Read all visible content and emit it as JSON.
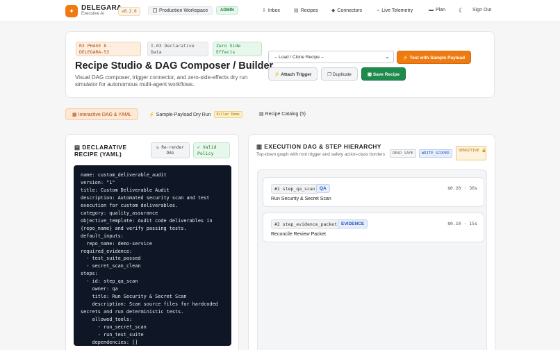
{
  "header": {
    "brand": "DELEGARA",
    "brand_sub": "Executive AI",
    "version": "v0.2.0",
    "workspace": "Production Workspace",
    "role_badge": "ADMIN",
    "nav": [
      {
        "label": "Inbox",
        "icon": "inbox-icon"
      },
      {
        "label": "Recipes",
        "icon": "recipes-icon"
      },
      {
        "label": "Connectors",
        "icon": "connectors-icon"
      },
      {
        "label": "Live Telemetry",
        "icon": "telemetry-icon"
      },
      {
        "label": "Plan",
        "icon": "plan-icon"
      }
    ],
    "sign_out": "Sign Out"
  },
  "hero": {
    "tags": [
      "R3 PHASE 8 - DELEGARA-53",
      "I-03 Declarative Data",
      "Zero Side Effects"
    ],
    "title": "Recipe Studio & DAG Composer / Builder",
    "description": "Visual DAG composer, trigger connector, and zero-side-effects dry run simulator for autonomous multi-agent workflows.",
    "select_value": "-- Load / Clone Recipe --",
    "test_button": "Test with Sample Payload",
    "attach_button": "Attach Trigger",
    "duplicate_button": "Duplicate",
    "save_button": "Save Recipe"
  },
  "tabs": {
    "dag_yaml": "Interactive DAG & YAML",
    "dry_run": "Sample-Payload Dry Run",
    "dry_run_badge": "Killer Demo",
    "catalog": "Recipe Catalog (5)"
  },
  "recipe_panel": {
    "title": "DECLARATIVE RECIPE (YAML)",
    "rerender_button": "↻ Re-render DAG",
    "valid_badge": "✓ Valid Policy",
    "yaml": "name: custom_deliverable_audit\nversion: \"1\"\ntitle: Custom Deliverable Audit\ndescription: Automated security scan and test\nexecution for custom deliverables.\ncategory: quality_assurance\nobjective_template: Audit code deliverables in\n{repo_name} and verify passing tests.\ndefault_inputs:\n  repo_name: demo-service\nrequired_evidence:\n  - test_suite_passed\n  - secret_scan_clean\nsteps:\n  - id: step_qa_scan\n    owner: qa\n    title: Run Security & Secret Scan\n    description: Scan source files for hardcoded\nsecrets and run deterministic tests.\n    allowed_tools:\n      - run_secret_scan\n      - run_test_suite\n    dependencies: []"
  },
  "dag_panel": {
    "title": "EXECUTION DAG & STEP HIERARCHY",
    "subtitle": "Top-down graph with root trigger and safety action-class borders",
    "legend": [
      "READ_SAFE",
      "WRITE_SCOPED",
      "SENSITIVE 🔒"
    ],
    "steps": [
      {
        "id": "#1 step_qa_scan",
        "role": "QA",
        "cost": "$0.20 · 30s",
        "title": "Run Security & Secret Scan"
      },
      {
        "id": "#2 step_evidence_packet",
        "role": "EVIDENCE",
        "cost": "$0.10 · 15s",
        "title": "Reconcile Review Packet"
      }
    ]
  },
  "colors": {
    "accent": "#f07a12",
    "success": "#1e8a4b",
    "code_bg": "#0f1726",
    "info": "#2957b5"
  }
}
